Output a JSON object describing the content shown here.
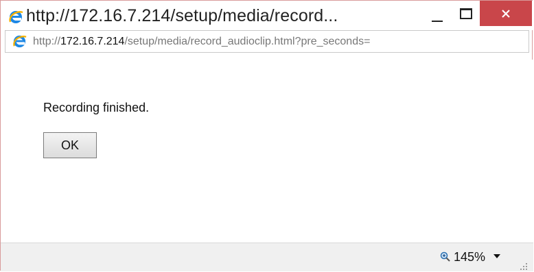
{
  "window": {
    "title": "http://172.16.7.214/setup/media/record...",
    "controls": {
      "minimize": "minimize",
      "maximize": "maximize",
      "close": "close"
    }
  },
  "address": {
    "prefix": "http://",
    "host": "172.16.7.214",
    "path": "/setup/media/record_audioclip.html?pre_seconds=",
    "icon": "ie-icon"
  },
  "content": {
    "message": "Recording finished.",
    "ok_label": "OK"
  },
  "status": {
    "zoom": "145%",
    "zoom_icon": "zoom-icon"
  },
  "colors": {
    "close_button": "#c9464a",
    "ie_blue": "#1e88e5",
    "ie_ring": "#f6b100"
  }
}
